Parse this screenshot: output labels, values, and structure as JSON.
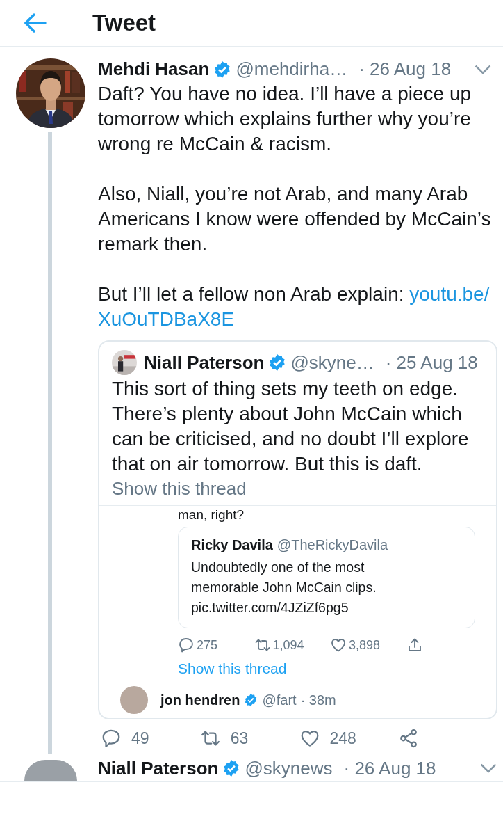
{
  "header": {
    "title": "Tweet"
  },
  "tweet": {
    "author": {
      "name": "Mehdi Hasan",
      "handle": "@mehdirha…",
      "verified": true
    },
    "date": "· 26 Aug 18",
    "paragraphs": [
      "Daft? You have no idea. I’ll have a piece up tomorrow which explains further why you’re wrong re McCain & racism.",
      "Also, Niall, you’re not Arab, and many Arab Americans I know were offended by McCain’s remark then.",
      "But I’ll let a fellow non Arab explain: "
    ],
    "link_lines": [
      "youtu.be/",
      "XuOuTDBaX8E"
    ],
    "quote": {
      "author": {
        "name": "Niall Paterson",
        "handle": "@skyne…",
        "verified": true
      },
      "date": "· 25 Aug 18",
      "text": "This sort of thing sets my teeth on edge. There’s plenty about John McCain which can be criticised, and no doubt I’ll explore that on air tomorrow. But this is daft.",
      "show_thread": "Show this thread",
      "screenshot": {
        "cut_text": "man, right?",
        "quote": {
          "name": "Ricky Davila",
          "handle": "@TheRickyDavila",
          "text": "Undoubtedly one of the most memorable John McCain clips. pic.twitter.com/4JZiZf6pg5"
        },
        "actions": [
          {
            "kind": "reply",
            "count": "275"
          },
          {
            "kind": "retweet",
            "count": "1,094"
          },
          {
            "kind": "like",
            "count": "3,898"
          },
          {
            "kind": "upload"
          }
        ],
        "show_thread": "Show this thread",
        "next": {
          "name": "jon hendren",
          "verified": true,
          "handle": "@fart",
          "time": "· 38m"
        }
      }
    },
    "actions": [
      {
        "kind": "reply",
        "count": "49"
      },
      {
        "kind": "retweet",
        "count": "63"
      },
      {
        "kind": "like",
        "count": "248"
      },
      {
        "kind": "share"
      }
    ]
  },
  "next_tweet": {
    "name": "Niall Paterson",
    "verified": true,
    "handle": "@skynews",
    "date": "· 26 Aug 18"
  }
}
